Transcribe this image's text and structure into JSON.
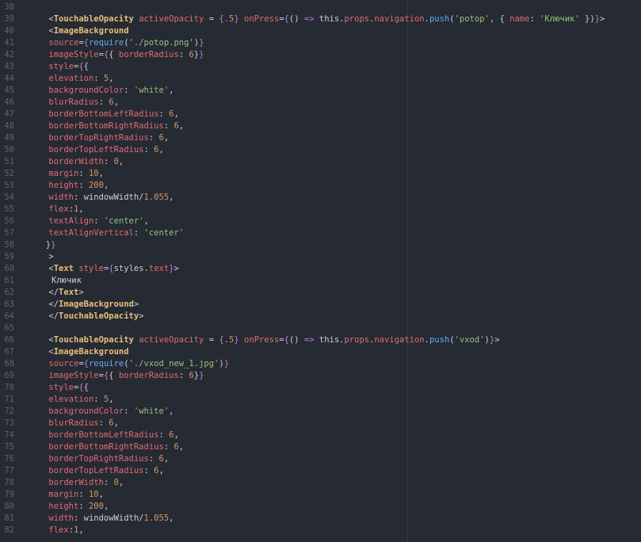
{
  "editor": {
    "first_line_number": 38,
    "lines": [
      {
        "indent": 0,
        "tokens": []
      },
      {
        "indent": 4,
        "tokens": [
          [
            "pl",
            "<"
          ],
          [
            "tag",
            "TouchableOpacity"
          ],
          [
            "pl",
            " "
          ],
          [
            "attr",
            "activeOpacity"
          ],
          [
            "pl",
            " = "
          ],
          [
            "br",
            "{"
          ],
          [
            "num",
            ".5"
          ],
          [
            "br",
            "}"
          ],
          [
            "pl",
            " "
          ],
          [
            "attr",
            "onPress"
          ],
          [
            "pl",
            "="
          ],
          [
            "br",
            "{"
          ],
          [
            "pl",
            "() "
          ],
          [
            "op",
            "=>"
          ],
          [
            "pl",
            " this."
          ],
          [
            "prop",
            "props"
          ],
          [
            "pl",
            "."
          ],
          [
            "prop",
            "navigation"
          ],
          [
            "pl",
            "."
          ],
          [
            "fn",
            "push"
          ],
          [
            "pl",
            "("
          ],
          [
            "str",
            "'potop'"
          ],
          [
            "pl",
            ", { "
          ],
          [
            "prop",
            "name"
          ],
          [
            "pl",
            ": "
          ],
          [
            "str",
            "'Ключик'"
          ],
          [
            "pl",
            " })"
          ],
          [
            "br",
            "}"
          ],
          [
            "pl",
            ">"
          ]
        ]
      },
      {
        "indent": 4,
        "tokens": [
          [
            "pl",
            "<"
          ],
          [
            "tag",
            "ImageBackground"
          ]
        ]
      },
      {
        "indent": 4,
        "tokens": [
          [
            "attr",
            "source"
          ],
          [
            "pl",
            "="
          ],
          [
            "br",
            "{"
          ],
          [
            "fn",
            "require"
          ],
          [
            "pl",
            "("
          ],
          [
            "str",
            "'./potop.png'"
          ],
          [
            "pl",
            ")"
          ],
          [
            "br",
            "}"
          ]
        ]
      },
      {
        "indent": 4,
        "tokens": [
          [
            "attr",
            "imageStyle"
          ],
          [
            "pl",
            "="
          ],
          [
            "br",
            "{"
          ],
          [
            "pl",
            "{ "
          ],
          [
            "prop",
            "borderRadius"
          ],
          [
            "pl",
            ": "
          ],
          [
            "num",
            "6"
          ],
          [
            "pl",
            "}"
          ],
          [
            "br",
            "}"
          ]
        ]
      },
      {
        "indent": 4,
        "tokens": [
          [
            "attr",
            "style"
          ],
          [
            "pl",
            "="
          ],
          [
            "br",
            "{"
          ],
          [
            "pl",
            "{"
          ]
        ]
      },
      {
        "indent": 4,
        "tokens": [
          [
            "prop",
            "elevation"
          ],
          [
            "pl",
            ": "
          ],
          [
            "num",
            "5"
          ],
          [
            "pl",
            ","
          ]
        ]
      },
      {
        "indent": 4,
        "tokens": [
          [
            "prop",
            "backgroundColor"
          ],
          [
            "pl",
            ": "
          ],
          [
            "str",
            "'white'"
          ],
          [
            "pl",
            ","
          ]
        ]
      },
      {
        "indent": 4,
        "tokens": [
          [
            "prop",
            "blurRadius"
          ],
          [
            "pl",
            ": "
          ],
          [
            "num",
            "6"
          ],
          [
            "pl",
            ","
          ]
        ]
      },
      {
        "indent": 4,
        "tokens": [
          [
            "prop",
            "borderBottomLeftRadius"
          ],
          [
            "pl",
            ": "
          ],
          [
            "num",
            "6"
          ],
          [
            "pl",
            ","
          ]
        ]
      },
      {
        "indent": 4,
        "tokens": [
          [
            "prop",
            "borderBottomRightRadius"
          ],
          [
            "pl",
            ": "
          ],
          [
            "num",
            "6"
          ],
          [
            "pl",
            ","
          ]
        ]
      },
      {
        "indent": 4,
        "tokens": [
          [
            "prop",
            "borderTopRightRadius"
          ],
          [
            "pl",
            ": "
          ],
          [
            "num",
            "6"
          ],
          [
            "pl",
            ","
          ]
        ]
      },
      {
        "indent": 4,
        "tokens": [
          [
            "prop",
            "borderTopLeftRadius"
          ],
          [
            "pl",
            ": "
          ],
          [
            "num",
            "6"
          ],
          [
            "pl",
            ","
          ]
        ]
      },
      {
        "indent": 4,
        "tokens": [
          [
            "prop",
            "borderWidth"
          ],
          [
            "pl",
            ": "
          ],
          [
            "num",
            "0"
          ],
          [
            "pl",
            ","
          ]
        ]
      },
      {
        "indent": 4,
        "tokens": [
          [
            "prop",
            "margin"
          ],
          [
            "pl",
            ": "
          ],
          [
            "num",
            "10"
          ],
          [
            "pl",
            ","
          ]
        ]
      },
      {
        "indent": 4,
        "tokens": [
          [
            "prop",
            "height"
          ],
          [
            "pl",
            ": "
          ],
          [
            "num",
            "200"
          ],
          [
            "pl",
            ","
          ]
        ]
      },
      {
        "indent": 4,
        "tokens": [
          [
            "prop",
            "width"
          ],
          [
            "pl",
            ": windowWidth/"
          ],
          [
            "num",
            "1.055"
          ],
          [
            "pl",
            ","
          ]
        ]
      },
      {
        "indent": 4,
        "tokens": [
          [
            "prop",
            "flex"
          ],
          [
            "pl",
            ":"
          ],
          [
            "num",
            "1"
          ],
          [
            "pl",
            ","
          ]
        ]
      },
      {
        "indent": 4,
        "tokens": [
          [
            "prop",
            "textAlign"
          ],
          [
            "pl",
            ": "
          ],
          [
            "str",
            "'center'"
          ],
          [
            "pl",
            ","
          ]
        ]
      },
      {
        "indent": 4,
        "tokens": [
          [
            "prop",
            "textAlignVertical"
          ],
          [
            "pl",
            ": "
          ],
          [
            "str",
            "'center'"
          ]
        ]
      },
      {
        "indent": 3,
        "tokens": [
          [
            "pl",
            "}"
          ],
          [
            "br",
            "}"
          ]
        ]
      },
      {
        "indent": 4,
        "tokens": [
          [
            "pl",
            ">"
          ]
        ]
      },
      {
        "indent": 4,
        "tokens": [
          [
            "pl",
            "<"
          ],
          [
            "tag",
            "Text"
          ],
          [
            "pl",
            " "
          ],
          [
            "attr",
            "style"
          ],
          [
            "pl",
            "="
          ],
          [
            "br",
            "{"
          ],
          [
            "pl",
            "styles."
          ],
          [
            "prop",
            "text"
          ],
          [
            "br",
            "}"
          ],
          [
            "pl",
            ">"
          ]
        ]
      },
      {
        "indent": 5,
        "tokens": [
          [
            "pl",
            "Ключик"
          ]
        ]
      },
      {
        "indent": 4,
        "tokens": [
          [
            "pl",
            "</"
          ],
          [
            "tag",
            "Text"
          ],
          [
            "pl",
            ">"
          ]
        ]
      },
      {
        "indent": 4,
        "tokens": [
          [
            "pl",
            "</"
          ],
          [
            "tag",
            "ImageBackground"
          ],
          [
            "pl",
            ">"
          ]
        ]
      },
      {
        "indent": 4,
        "tokens": [
          [
            "pl",
            "</"
          ],
          [
            "tag",
            "TouchableOpacity"
          ],
          [
            "pl",
            ">"
          ]
        ]
      },
      {
        "indent": 0,
        "tokens": []
      },
      {
        "indent": 4,
        "tokens": [
          [
            "pl",
            "<"
          ],
          [
            "tag",
            "TouchableOpacity"
          ],
          [
            "pl",
            " "
          ],
          [
            "attr",
            "activeOpacity"
          ],
          [
            "pl",
            " = "
          ],
          [
            "br",
            "{"
          ],
          [
            "num",
            ".5"
          ],
          [
            "br",
            "}"
          ],
          [
            "pl",
            " "
          ],
          [
            "attr",
            "onPress"
          ],
          [
            "pl",
            "="
          ],
          [
            "br",
            "{"
          ],
          [
            "pl",
            "() "
          ],
          [
            "op",
            "=>"
          ],
          [
            "pl",
            " this."
          ],
          [
            "prop",
            "props"
          ],
          [
            "pl",
            "."
          ],
          [
            "prop",
            "navigation"
          ],
          [
            "pl",
            "."
          ],
          [
            "fn",
            "push"
          ],
          [
            "pl",
            "("
          ],
          [
            "str",
            "'vxod'"
          ],
          [
            "pl",
            ")"
          ],
          [
            "br",
            "}"
          ],
          [
            "pl",
            ">"
          ]
        ]
      },
      {
        "indent": 4,
        "tokens": [
          [
            "pl",
            "<"
          ],
          [
            "tag",
            "ImageBackground"
          ]
        ]
      },
      {
        "indent": 4,
        "tokens": [
          [
            "attr",
            "source"
          ],
          [
            "pl",
            "="
          ],
          [
            "br",
            "{"
          ],
          [
            "fn",
            "require"
          ],
          [
            "pl",
            "("
          ],
          [
            "str",
            "'./vxod_new_1.jpg'"
          ],
          [
            "pl",
            ")"
          ],
          [
            "br",
            "}"
          ]
        ]
      },
      {
        "indent": 4,
        "tokens": [
          [
            "attr",
            "imageStyle"
          ],
          [
            "pl",
            "="
          ],
          [
            "br",
            "{"
          ],
          [
            "pl",
            "{ "
          ],
          [
            "prop",
            "borderRadius"
          ],
          [
            "pl",
            ": "
          ],
          [
            "num",
            "6"
          ],
          [
            "pl",
            "}"
          ],
          [
            "br",
            "}"
          ]
        ]
      },
      {
        "indent": 4,
        "tokens": [
          [
            "attr",
            "style"
          ],
          [
            "pl",
            "="
          ],
          [
            "br",
            "{"
          ],
          [
            "pl",
            "{"
          ]
        ]
      },
      {
        "indent": 4,
        "tokens": [
          [
            "prop",
            "elevation"
          ],
          [
            "pl",
            ": "
          ],
          [
            "num",
            "5"
          ],
          [
            "pl",
            ","
          ]
        ]
      },
      {
        "indent": 4,
        "tokens": [
          [
            "prop",
            "backgroundColor"
          ],
          [
            "pl",
            ": "
          ],
          [
            "str",
            "'white'"
          ],
          [
            "pl",
            ","
          ]
        ]
      },
      {
        "indent": 4,
        "tokens": [
          [
            "prop",
            "blurRadius"
          ],
          [
            "pl",
            ": "
          ],
          [
            "num",
            "6"
          ],
          [
            "pl",
            ","
          ]
        ]
      },
      {
        "indent": 4,
        "tokens": [
          [
            "prop",
            "borderBottomLeftRadius"
          ],
          [
            "pl",
            ": "
          ],
          [
            "num",
            "6"
          ],
          [
            "pl",
            ","
          ]
        ]
      },
      {
        "indent": 4,
        "tokens": [
          [
            "prop",
            "borderBottomRightRadius"
          ],
          [
            "pl",
            ": "
          ],
          [
            "num",
            "6"
          ],
          [
            "pl",
            ","
          ]
        ]
      },
      {
        "indent": 4,
        "tokens": [
          [
            "prop",
            "borderTopRightRadius"
          ],
          [
            "pl",
            ": "
          ],
          [
            "num",
            "6"
          ],
          [
            "pl",
            ","
          ]
        ]
      },
      {
        "indent": 4,
        "tokens": [
          [
            "prop",
            "borderTopLeftRadius"
          ],
          [
            "pl",
            ": "
          ],
          [
            "num",
            "6"
          ],
          [
            "pl",
            ","
          ]
        ]
      },
      {
        "indent": 4,
        "tokens": [
          [
            "prop",
            "borderWidth"
          ],
          [
            "pl",
            ": "
          ],
          [
            "num",
            "0"
          ],
          [
            "pl",
            ","
          ]
        ]
      },
      {
        "indent": 4,
        "tokens": [
          [
            "prop",
            "margin"
          ],
          [
            "pl",
            ": "
          ],
          [
            "num",
            "10"
          ],
          [
            "pl",
            ","
          ]
        ]
      },
      {
        "indent": 4,
        "tokens": [
          [
            "prop",
            "height"
          ],
          [
            "pl",
            ": "
          ],
          [
            "num",
            "200"
          ],
          [
            "pl",
            ","
          ]
        ]
      },
      {
        "indent": 4,
        "tokens": [
          [
            "prop",
            "width"
          ],
          [
            "pl",
            ": windowWidth/"
          ],
          [
            "num",
            "1.055"
          ],
          [
            "pl",
            ","
          ]
        ]
      },
      {
        "indent": 4,
        "tokens": [
          [
            "prop",
            "flex"
          ],
          [
            "pl",
            ":"
          ],
          [
            "num",
            "1"
          ],
          [
            "pl",
            ","
          ]
        ]
      }
    ]
  },
  "colors": {
    "background": "#262a33",
    "line_number": "#5c6370",
    "tag": "#e5c07b",
    "attribute": "#e06c75",
    "string": "#98c379",
    "number": "#d19a66",
    "keyword": "#c678dd",
    "function": "#61afef",
    "plain": "#c9d1d9"
  }
}
